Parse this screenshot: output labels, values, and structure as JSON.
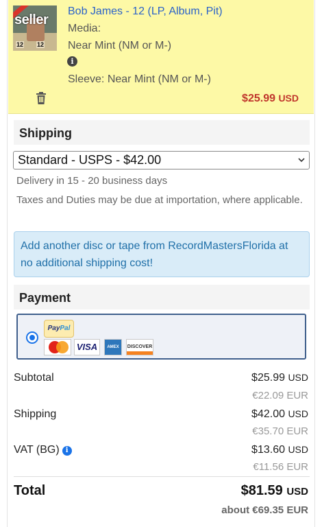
{
  "item": {
    "thumbnail_text": "seller",
    "title": "Bob James - 12 (LP, Album, Pit)",
    "media_label": "Media:",
    "media_condition": "Near Mint (NM or M-)",
    "sleeve": "Sleeve: Near Mint (NM or M-)",
    "price_amount": "$25.99",
    "price_currency": "USD",
    "price_color": "#c0362c"
  },
  "shipping": {
    "heading": "Shipping",
    "selected_option": "Standard - USPS - $42.00",
    "delivery": "Delivery in 15 - 20 business days",
    "taxes_note": "Taxes and Duties may be due at importation, where applicable."
  },
  "notice": {
    "text": "Add another disc or tape from RecordMastersFlorida at no additional shipping cost!"
  },
  "payment": {
    "heading": "Payment",
    "methods": [
      "PayPal",
      "MasterCard",
      "VISA",
      "AMEX",
      "DISCOVER"
    ]
  },
  "summary": {
    "subtotal_label": "Subtotal",
    "subtotal_usd": "$25.99",
    "subtotal_eur": "€22.09 EUR",
    "shipping_label": "Shipping",
    "shipping_usd": "$42.00",
    "shipping_eur": "€35.70 EUR",
    "vat_label": "VAT (BG)",
    "vat_usd": "$13.60",
    "vat_eur": "€11.56 EUR",
    "currency": "USD",
    "total_label": "Total",
    "total_usd": "$81.59",
    "about": "about €69.35 EUR"
  },
  "colors": {
    "item_background": "#fdf9a6",
    "link": "#2a62c9",
    "notice_text": "#1f6fa8",
    "notice_background": "#d9ecf8",
    "radio": "#1a73e8"
  },
  "icons": [
    "info-icon",
    "trash-icon",
    "chevron-down-icon",
    "radio-selected-icon"
  ]
}
